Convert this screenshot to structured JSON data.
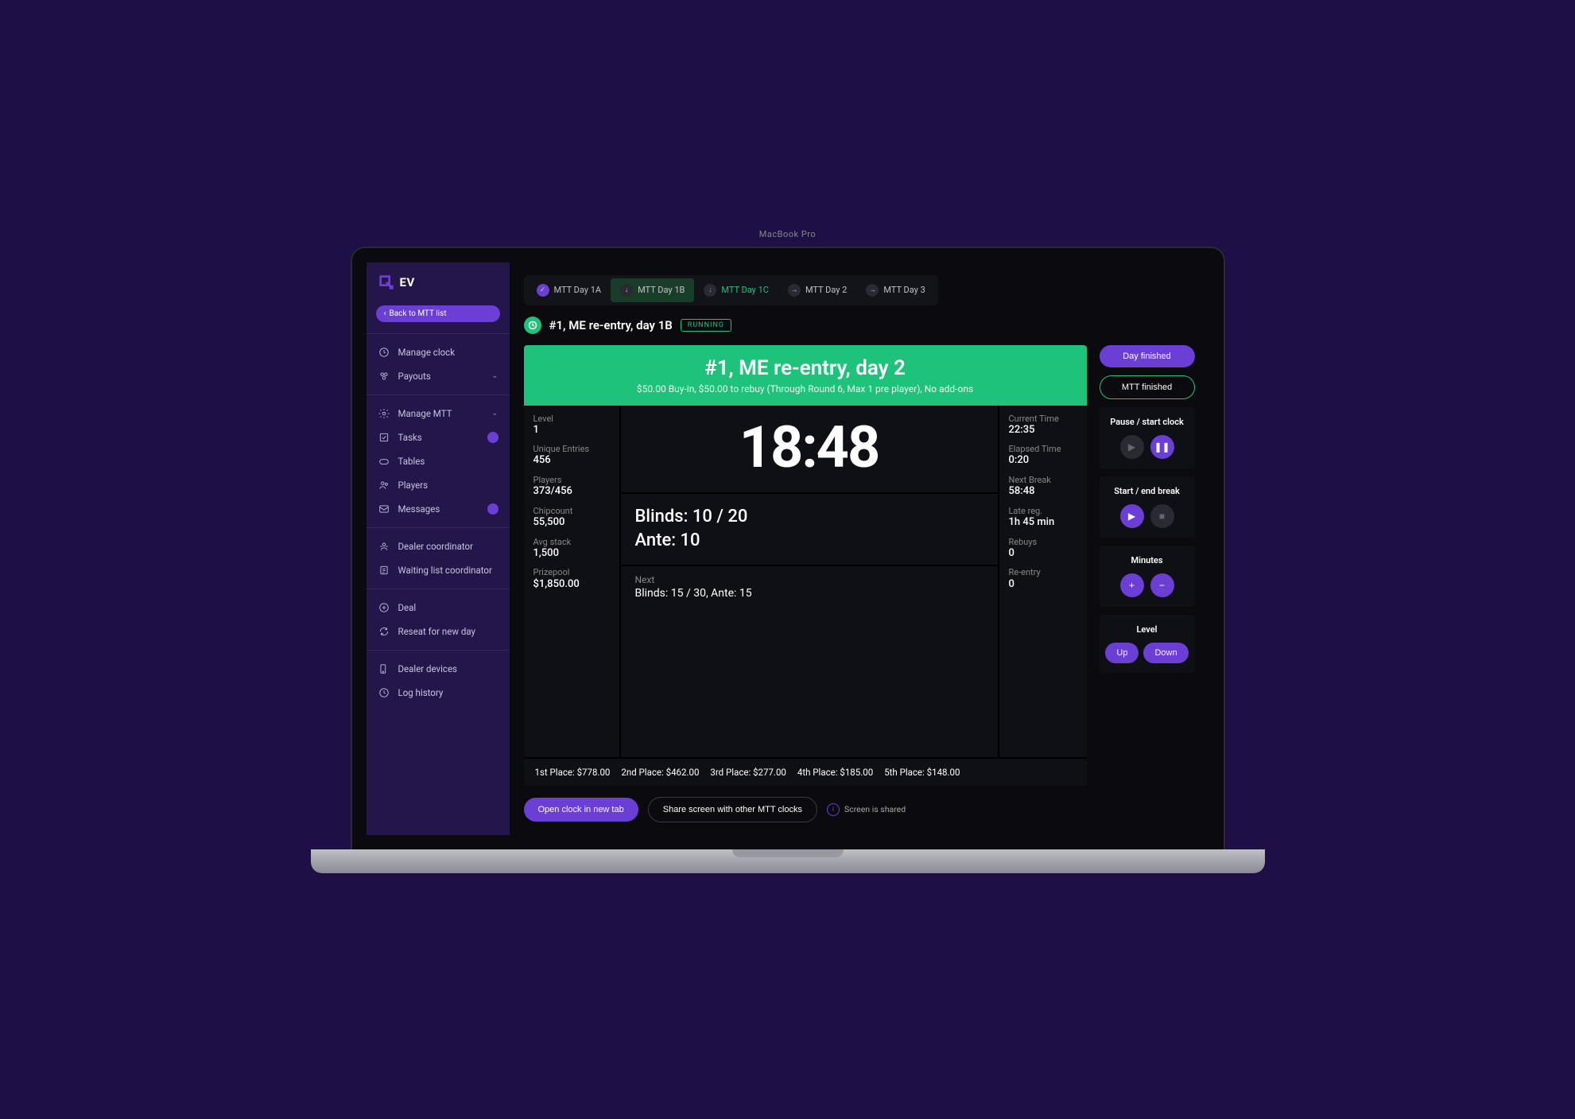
{
  "logo": {
    "text": "EV"
  },
  "back": {
    "label": "Back to MTT list"
  },
  "sidebar": {
    "groups": [
      {
        "items": [
          {
            "icon": "clock",
            "label": "Manage clock"
          },
          {
            "icon": "payouts",
            "label": "Payouts",
            "chev": true
          }
        ]
      },
      {
        "items": [
          {
            "icon": "gear",
            "label": "Manage MTT",
            "chev": true
          },
          {
            "icon": "tasks",
            "label": "Tasks",
            "badge": " "
          },
          {
            "icon": "tables",
            "label": "Tables"
          },
          {
            "icon": "players",
            "label": "Players"
          },
          {
            "icon": "messages",
            "label": "Messages",
            "badge": " "
          }
        ]
      },
      {
        "items": [
          {
            "icon": "dealer",
            "label": "Dealer coordinator"
          },
          {
            "icon": "waiting",
            "label": "Waiting list coordinator"
          }
        ]
      },
      {
        "items": [
          {
            "icon": "deal",
            "label": "Deal"
          },
          {
            "icon": "reseat",
            "label": "Reseat for new day"
          }
        ]
      },
      {
        "items": [
          {
            "icon": "devices",
            "label": "Dealer devices"
          },
          {
            "icon": "log",
            "label": "Log history"
          }
        ]
      }
    ]
  },
  "tabs": [
    {
      "label": "MTT Day 1A",
      "icon": "check"
    },
    {
      "label": "MTT Day 1B",
      "icon": "down",
      "active": true
    },
    {
      "label": "MTT Day 1C",
      "icon": "down",
      "green": true
    },
    {
      "label": "MTT Day 2",
      "icon": "arrow"
    },
    {
      "label": "MTT Day 3",
      "icon": "arrow"
    }
  ],
  "header": {
    "title": "#1, ME re-entry, day 1B",
    "status": "RUNNING"
  },
  "banner": {
    "title": "#1, ME re-entry, day 2",
    "subtitle": "$50.00 Buy-in, $50.00 to rebuy (Through Round 6, Max 1 pre player), No add-ons"
  },
  "stats_left": [
    {
      "label": "Level",
      "value": "1"
    },
    {
      "label": "Unique Entries",
      "value": "456"
    },
    {
      "label": "Players",
      "value": "373/456"
    },
    {
      "label": "Chipcount",
      "value": "55,500"
    },
    {
      "label": "Avg stack",
      "value": "1,500"
    },
    {
      "label": "Prizepool",
      "value": "$1,850.00"
    }
  ],
  "clock": {
    "time": "18:48",
    "blinds_line": "Blinds: 10 / 20",
    "ante_line": "Ante: 10",
    "next_label": "Next",
    "next_value": "Blinds: 15 / 30, Ante: 15"
  },
  "stats_right": [
    {
      "label": "Current Time",
      "value": "22:35"
    },
    {
      "label": "Elapsed Time",
      "value": "0:20"
    },
    {
      "label": "Next Break",
      "value": "58:48"
    },
    {
      "label": "Late reg.",
      "value": "1h 45 min"
    },
    {
      "label": "Rebuys",
      "value": "0"
    },
    {
      "label": "Re-entry",
      "value": "0"
    }
  ],
  "payouts": [
    "1st Place: $778.00",
    "2nd Place: $462.00",
    "3rd Place: $277.00",
    "4th Place: $185.00",
    "5th Place: $148.00"
  ],
  "controls": {
    "day_finished": "Day finished",
    "mtt_finished": "MTT finished",
    "pause_title": "Pause / start clock",
    "break_title": "Start / end break",
    "minutes_title": "Minutes",
    "level_title": "Level",
    "level_up": "Up",
    "level_down": "Down"
  },
  "footer": {
    "open_tab": "Open clock in new tab",
    "share": "Share screen with other MTT clocks",
    "shared": "Screen is shared"
  },
  "laptop_label": "MacBook Pro"
}
